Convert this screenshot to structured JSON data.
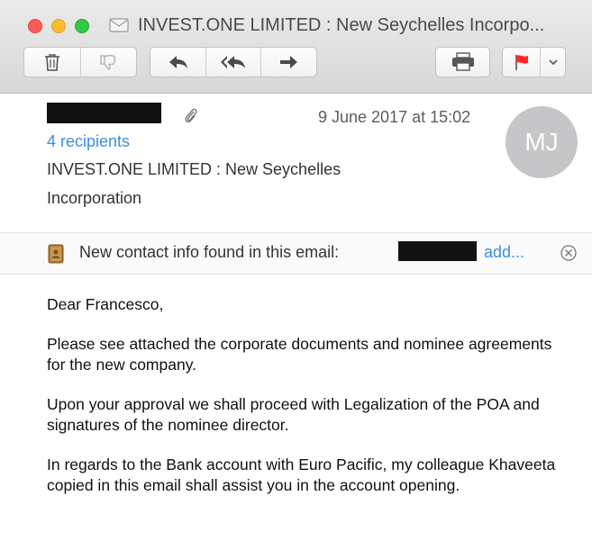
{
  "window": {
    "title": "INVEST.ONE LIMITED : New Seychelles Incorpo..."
  },
  "toolbar": {
    "buttons": [
      "delete",
      "junk",
      "reply",
      "reply-all",
      "forward",
      "print",
      "flag",
      "flag-menu"
    ],
    "flag_color": "#ff2a2a"
  },
  "message": {
    "date": "9 June 2017 at 15:02",
    "recipients_label": "4 recipients",
    "subject": "INVEST.ONE LIMITED : New Seychelles Incorporation",
    "avatar_initials": "MJ"
  },
  "contact_banner": {
    "text": "New contact info found in this email:",
    "add_label": "add..."
  },
  "body": {
    "greeting": "Dear Francesco,",
    "paragraph1": "Please see attached the corporate documents and nominee agreements for the new company.",
    "paragraph2": "Upon your approval we shall proceed with Legalization of the POA and signatures of the nominee director.",
    "paragraph3": "In regards to the Bank account with Euro Pacific, my colleague Khaveeta copied in this email shall assist you in the account opening."
  },
  "colors": {
    "link": "#3d8fe0",
    "avatar_bg": "#c6c6c8"
  }
}
